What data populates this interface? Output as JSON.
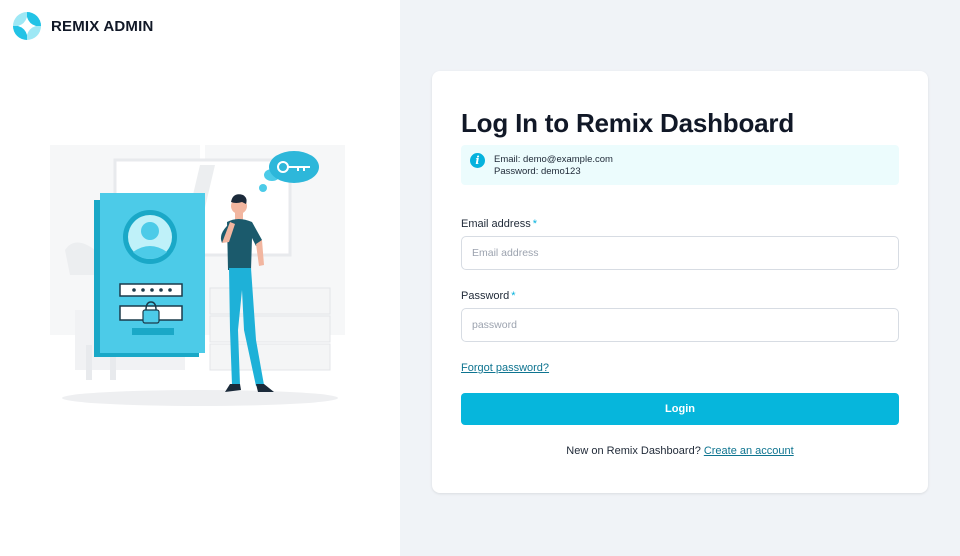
{
  "brand": {
    "name": "REMIX ADMIN",
    "logo_icon": "remix-logo-icon"
  },
  "illustration": {
    "icon": "login-illustration"
  },
  "login": {
    "title": "Log In to Remix Dashboard",
    "info": {
      "icon": "info-icon",
      "email_line": "Email: demo@example.com",
      "password_line": "Password: demo123"
    },
    "email": {
      "label": "Email address",
      "required": "*",
      "placeholder": "Email address",
      "value": ""
    },
    "password": {
      "label": "Password",
      "required": "*",
      "placeholder": "password",
      "value": ""
    },
    "forgot_label": "Forgot password?",
    "button_label": "Login",
    "signup_text": "New on Remix Dashboard?",
    "signup_link": "Create an account"
  },
  "colors": {
    "accent": "#06b6dc",
    "info_bg": "#ecfcfd",
    "link": "#0e7490",
    "panel_bg": "#f0f3f7"
  }
}
